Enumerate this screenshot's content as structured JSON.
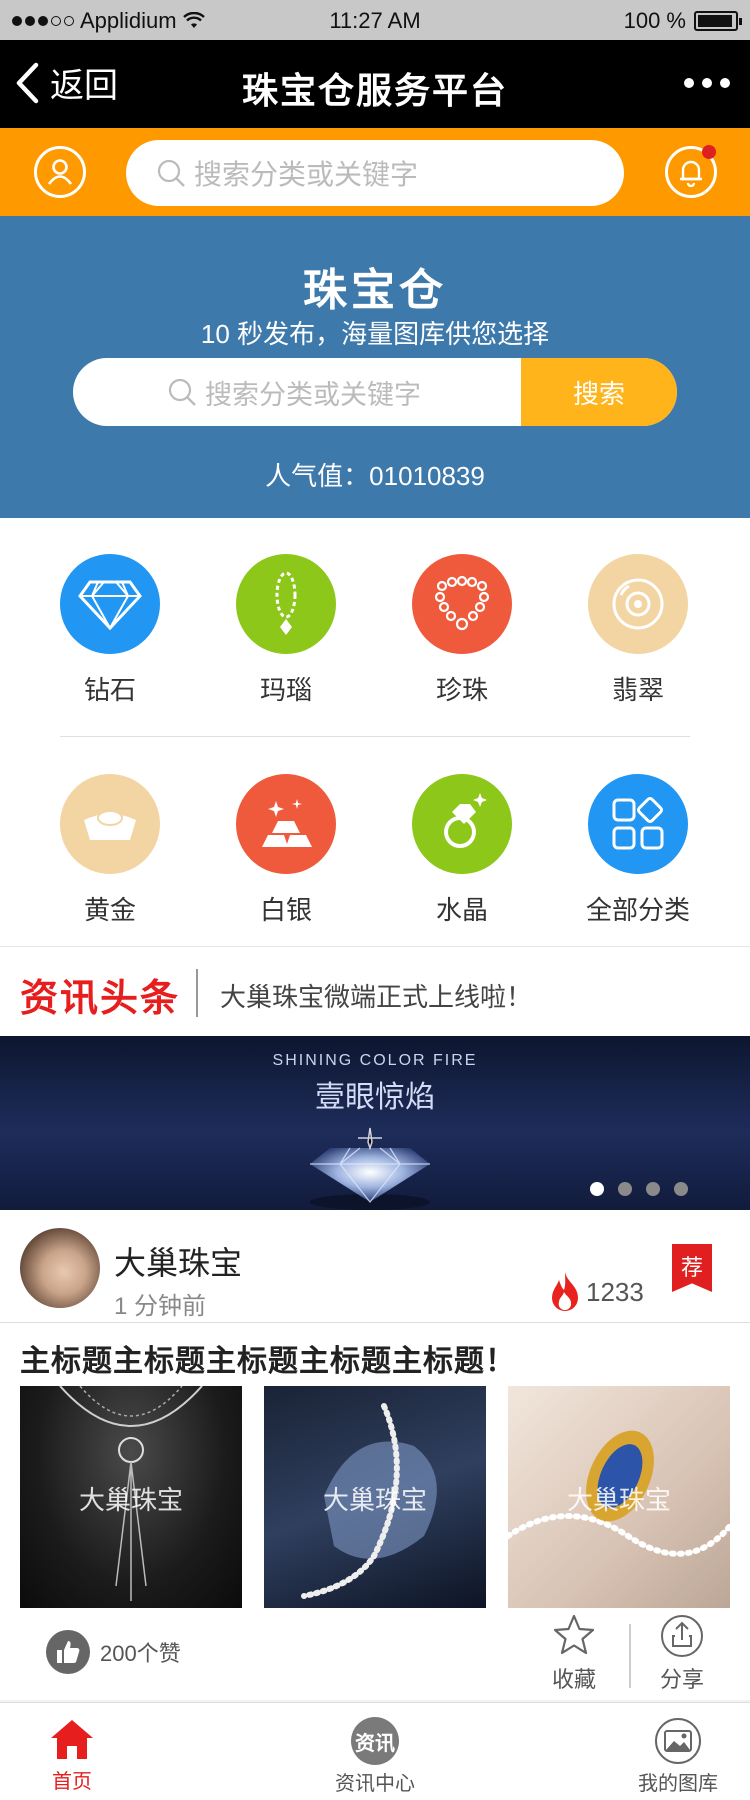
{
  "status_bar": {
    "carrier": "Applidium",
    "time": "11:27 AM",
    "battery": "100 %"
  },
  "nav": {
    "back_label": "返回",
    "title": "珠宝仓服务平台"
  },
  "top_search": {
    "placeholder": "搜索分类或关键字"
  },
  "hero": {
    "title": "珠宝仓",
    "subtitle": "10 秒发布，海量图库供您选择",
    "search_placeholder": "搜索分类或关键字",
    "search_button": "搜索",
    "popularity": "人气值：01010839"
  },
  "categories": [
    {
      "label": "钻石",
      "icon": "diamond-icon",
      "color": "#2196f3"
    },
    {
      "label": "玛瑙",
      "icon": "agate-icon",
      "color": "#8cc71a"
    },
    {
      "label": "珍珠",
      "icon": "pearl-necklace-icon",
      "color": "#f05a3c"
    },
    {
      "label": "翡翠",
      "icon": "jade-disc-icon",
      "color": "#f3d5a3"
    },
    {
      "label": "黄金",
      "icon": "gold-ingot-icon",
      "color": "#f3d5a3"
    },
    {
      "label": "白银",
      "icon": "silver-bars-icon",
      "color": "#f05a3c"
    },
    {
      "label": "水晶",
      "icon": "crystal-ring-icon",
      "color": "#8cc71a"
    },
    {
      "label": "全部分类",
      "icon": "all-categories-icon",
      "color": "#2196f3"
    }
  ],
  "news": {
    "tag": "资讯头条",
    "headline": "大巢珠宝微端正式上线啦！"
  },
  "banner": {
    "title_en": "SHINING COLOR FIRE",
    "title_cn": "壹眼惊焰",
    "pages": 4,
    "active_page": 1
  },
  "post": {
    "author": "大巢珠宝",
    "time_ago": "1 分钟前",
    "hot_count": "1233",
    "badge": "荐",
    "title": "主标题主标题主标题主标题主标题！",
    "thumbnails": [
      {
        "watermark": "大巢珠宝"
      },
      {
        "watermark": "大巢珠宝"
      },
      {
        "watermark": "大巢珠宝"
      }
    ],
    "likes": "200个赞",
    "favorite_label": "收藏",
    "share_label": "分享"
  },
  "tabbar": [
    {
      "label": "首页",
      "icon": "home-icon",
      "active": true
    },
    {
      "label": "资讯中心",
      "icon": "news-icon",
      "icon_text": "资讯",
      "active": false
    },
    {
      "label": "我的图库",
      "icon": "gallery-icon",
      "active": false
    }
  ]
}
